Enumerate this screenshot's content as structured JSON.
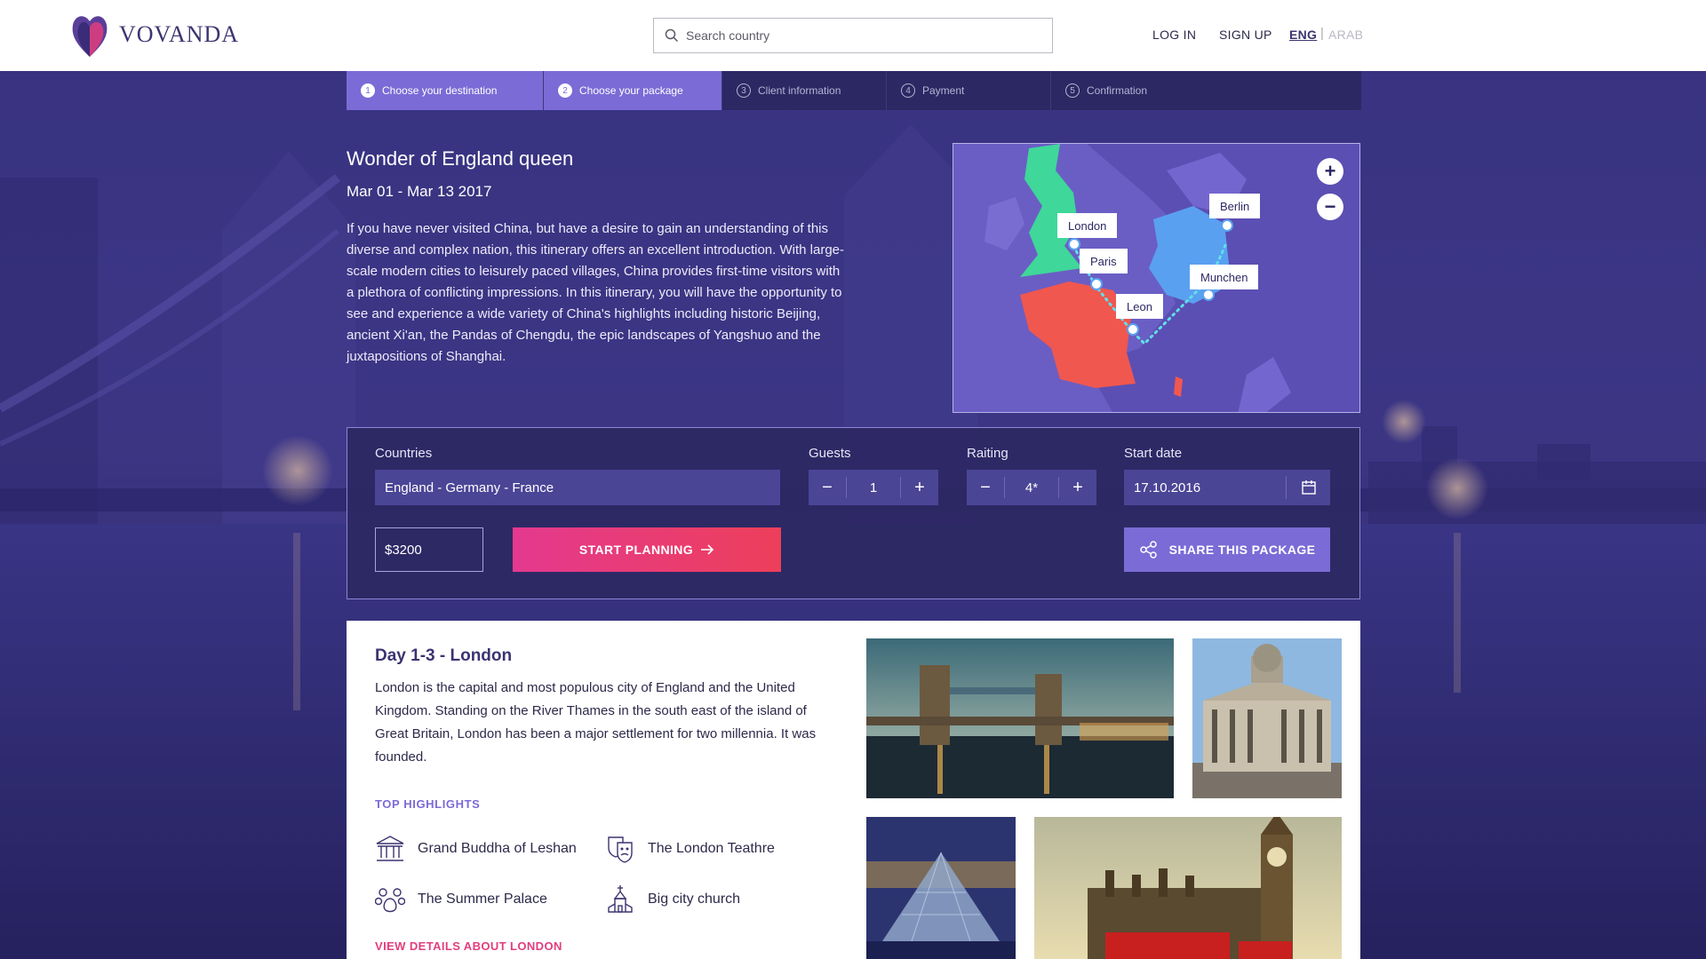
{
  "header": {
    "brand": "VOVANDA",
    "search_placeholder": "Search country",
    "login": "LOG IN",
    "signup": "SIGN UP",
    "lang_active": "ENG",
    "lang_inactive": "ARAB"
  },
  "steps": [
    {
      "num": "1",
      "label": "Choose your destination",
      "active": true
    },
    {
      "num": "2",
      "label": "Choose your package",
      "active": true
    },
    {
      "num": "3",
      "label": "Client information",
      "active": false
    },
    {
      "num": "4",
      "label": "Payment",
      "active": false
    },
    {
      "num": "5",
      "label": "Confirmation",
      "active": false
    }
  ],
  "tour": {
    "title": "Wonder of England queen",
    "dates": "Mar 01 - Mar 13 2017",
    "description": "If you have never visited China, but have a desire to gain an understanding of this diverse and complex nation, this itinerary offers an excellent introduction. With large-scale modern cities to leisurely paced villages, China provides first-time visitors with a plethora of conflicting impressions. In this itinerary, you will have the opportunity to see and experience a wide variety of China's highlights including historic Beijing, ancient Xi'an, the Pandas of Chengdu, the epic landscapes of Yangshuo and the juxtapositions of Shanghai."
  },
  "map": {
    "cities": [
      "London",
      "Paris",
      "Leon",
      "Berlin",
      "Munchen"
    ],
    "zoom_in": "+",
    "zoom_out": "−",
    "colors": {
      "england": "#3fd79a",
      "france": "#f0574f",
      "germany": "#5aa0f0",
      "route": "#5fe0e8"
    }
  },
  "booking": {
    "countries_label": "Countries",
    "countries_value": "England - Germany - France",
    "guests_label": "Guests",
    "guests_value": "1",
    "rating_label": "Raiting",
    "rating_value": "4*",
    "start_date_label": "Start date",
    "start_date_value": "17.10.2016",
    "price": "$3200",
    "start_button": "START PLANNING",
    "share_button": "SHARE THIS PACKAGE",
    "minus": "−",
    "plus": "+"
  },
  "day": {
    "title": "Day 1-3 - London",
    "description": "London is the capital and most populous city of England and the United Kingdom. Standing on the River Thames in the south east of the island of Great Britain, London has been a major settlement for two millennia. It was founded.",
    "highlights_title": "TOP HIGHLIGHTS",
    "highlights": [
      {
        "label": "Grand Buddha of Leshan",
        "icon": "museum-icon"
      },
      {
        "label": "The London Teathre",
        "icon": "theatre-masks-icon"
      },
      {
        "label": "The Summer Palace",
        "icon": "paw-icon"
      },
      {
        "label": "Big city church",
        "icon": "church-icon"
      }
    ],
    "view_details": "VIEW DETAILS ABOUT LONDON"
  },
  "colors": {
    "brand": "#3b3470",
    "accent": "#7b6bd6",
    "cta": "#e8398a",
    "panel": "#2c2863"
  }
}
